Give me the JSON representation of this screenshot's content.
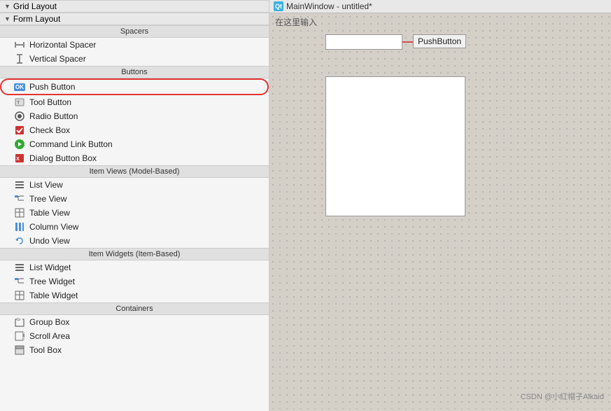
{
  "leftPanel": {
    "sections": [
      {
        "type": "header",
        "label": "Spacers"
      },
      {
        "type": "items",
        "items": [
          {
            "id": "horizontal-spacer",
            "label": "Horizontal Spacer",
            "icon": "h-spacer"
          },
          {
            "id": "vertical-spacer",
            "label": "Vertical Spacer",
            "icon": "v-spacer"
          }
        ]
      },
      {
        "type": "header",
        "label": "Buttons"
      },
      {
        "type": "items",
        "items": [
          {
            "id": "push-button",
            "label": "Push Button",
            "icon": "ok",
            "highlighted": true
          },
          {
            "id": "tool-button",
            "label": "Tool Button",
            "icon": "tool"
          },
          {
            "id": "radio-button",
            "label": "Radio Button",
            "icon": "radio"
          },
          {
            "id": "check-box",
            "label": "Check Box",
            "icon": "check"
          },
          {
            "id": "command-link-button",
            "label": "Command Link Button",
            "icon": "cmd"
          },
          {
            "id": "dialog-button-box",
            "label": "Dialog Button Box",
            "icon": "dialog"
          }
        ]
      },
      {
        "type": "header",
        "label": "Item Views (Model-Based)"
      },
      {
        "type": "items",
        "items": [
          {
            "id": "list-view",
            "label": "List View",
            "icon": "list"
          },
          {
            "id": "tree-view",
            "label": "Tree View",
            "icon": "tree"
          },
          {
            "id": "table-view",
            "label": "Table View",
            "icon": "table"
          },
          {
            "id": "column-view",
            "label": "Column View",
            "icon": "col"
          },
          {
            "id": "undo-view",
            "label": "Undo View",
            "icon": "undo"
          }
        ]
      },
      {
        "type": "header",
        "label": "Item Widgets (Item-Based)"
      },
      {
        "type": "items",
        "items": [
          {
            "id": "list-widget",
            "label": "List Widget",
            "icon": "list"
          },
          {
            "id": "tree-widget",
            "label": "Tree Widget",
            "icon": "tree"
          },
          {
            "id": "table-widget",
            "label": "Table Widget",
            "icon": "table"
          }
        ]
      },
      {
        "type": "header",
        "label": "Containers"
      },
      {
        "type": "items",
        "items": [
          {
            "id": "group-box",
            "label": "Group Box",
            "icon": "box"
          },
          {
            "id": "scroll-area",
            "label": "Scroll Area",
            "icon": "scroll"
          },
          {
            "id": "tool-box",
            "label": "Tool Box",
            "icon": "toolbox"
          }
        ]
      }
    ]
  },
  "rightPanel": {
    "titleBar": {
      "qtLabel": "Qt",
      "title": "MainWindow - untitled*"
    },
    "placeholderText": "在这里输入",
    "pushButtonLabel": "PushButton",
    "watermark": "CSDN @小红帽子Alkaid"
  }
}
